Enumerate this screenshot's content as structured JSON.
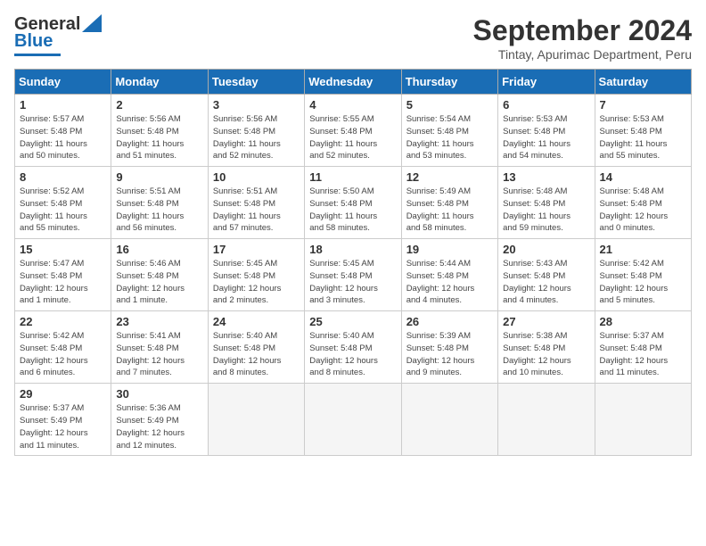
{
  "header": {
    "logo_line1": "General",
    "logo_line2": "Blue",
    "title": "September 2024",
    "subtitle": "Tintay, Apurimac Department, Peru"
  },
  "weekdays": [
    "Sunday",
    "Monday",
    "Tuesday",
    "Wednesday",
    "Thursday",
    "Friday",
    "Saturday"
  ],
  "weeks": [
    [
      {
        "day": "1",
        "info": "Sunrise: 5:57 AM\nSunset: 5:48 PM\nDaylight: 11 hours\nand 50 minutes."
      },
      {
        "day": "2",
        "info": "Sunrise: 5:56 AM\nSunset: 5:48 PM\nDaylight: 11 hours\nand 51 minutes."
      },
      {
        "day": "3",
        "info": "Sunrise: 5:56 AM\nSunset: 5:48 PM\nDaylight: 11 hours\nand 52 minutes."
      },
      {
        "day": "4",
        "info": "Sunrise: 5:55 AM\nSunset: 5:48 PM\nDaylight: 11 hours\nand 52 minutes."
      },
      {
        "day": "5",
        "info": "Sunrise: 5:54 AM\nSunset: 5:48 PM\nDaylight: 11 hours\nand 53 minutes."
      },
      {
        "day": "6",
        "info": "Sunrise: 5:53 AM\nSunset: 5:48 PM\nDaylight: 11 hours\nand 54 minutes."
      },
      {
        "day": "7",
        "info": "Sunrise: 5:53 AM\nSunset: 5:48 PM\nDaylight: 11 hours\nand 55 minutes."
      }
    ],
    [
      {
        "day": "8",
        "info": "Sunrise: 5:52 AM\nSunset: 5:48 PM\nDaylight: 11 hours\nand 55 minutes."
      },
      {
        "day": "9",
        "info": "Sunrise: 5:51 AM\nSunset: 5:48 PM\nDaylight: 11 hours\nand 56 minutes."
      },
      {
        "day": "10",
        "info": "Sunrise: 5:51 AM\nSunset: 5:48 PM\nDaylight: 11 hours\nand 57 minutes."
      },
      {
        "day": "11",
        "info": "Sunrise: 5:50 AM\nSunset: 5:48 PM\nDaylight: 11 hours\nand 58 minutes."
      },
      {
        "day": "12",
        "info": "Sunrise: 5:49 AM\nSunset: 5:48 PM\nDaylight: 11 hours\nand 58 minutes."
      },
      {
        "day": "13",
        "info": "Sunrise: 5:48 AM\nSunset: 5:48 PM\nDaylight: 11 hours\nand 59 minutes."
      },
      {
        "day": "14",
        "info": "Sunrise: 5:48 AM\nSunset: 5:48 PM\nDaylight: 12 hours\nand 0 minutes."
      }
    ],
    [
      {
        "day": "15",
        "info": "Sunrise: 5:47 AM\nSunset: 5:48 PM\nDaylight: 12 hours\nand 1 minute."
      },
      {
        "day": "16",
        "info": "Sunrise: 5:46 AM\nSunset: 5:48 PM\nDaylight: 12 hours\nand 1 minute."
      },
      {
        "day": "17",
        "info": "Sunrise: 5:45 AM\nSunset: 5:48 PM\nDaylight: 12 hours\nand 2 minutes."
      },
      {
        "day": "18",
        "info": "Sunrise: 5:45 AM\nSunset: 5:48 PM\nDaylight: 12 hours\nand 3 minutes."
      },
      {
        "day": "19",
        "info": "Sunrise: 5:44 AM\nSunset: 5:48 PM\nDaylight: 12 hours\nand 4 minutes."
      },
      {
        "day": "20",
        "info": "Sunrise: 5:43 AM\nSunset: 5:48 PM\nDaylight: 12 hours\nand 4 minutes."
      },
      {
        "day": "21",
        "info": "Sunrise: 5:42 AM\nSunset: 5:48 PM\nDaylight: 12 hours\nand 5 minutes."
      }
    ],
    [
      {
        "day": "22",
        "info": "Sunrise: 5:42 AM\nSunset: 5:48 PM\nDaylight: 12 hours\nand 6 minutes."
      },
      {
        "day": "23",
        "info": "Sunrise: 5:41 AM\nSunset: 5:48 PM\nDaylight: 12 hours\nand 7 minutes."
      },
      {
        "day": "24",
        "info": "Sunrise: 5:40 AM\nSunset: 5:48 PM\nDaylight: 12 hours\nand 8 minutes."
      },
      {
        "day": "25",
        "info": "Sunrise: 5:40 AM\nSunset: 5:48 PM\nDaylight: 12 hours\nand 8 minutes."
      },
      {
        "day": "26",
        "info": "Sunrise: 5:39 AM\nSunset: 5:48 PM\nDaylight: 12 hours\nand 9 minutes."
      },
      {
        "day": "27",
        "info": "Sunrise: 5:38 AM\nSunset: 5:48 PM\nDaylight: 12 hours\nand 10 minutes."
      },
      {
        "day": "28",
        "info": "Sunrise: 5:37 AM\nSunset: 5:48 PM\nDaylight: 12 hours\nand 11 minutes."
      }
    ],
    [
      {
        "day": "29",
        "info": "Sunrise: 5:37 AM\nSunset: 5:49 PM\nDaylight: 12 hours\nand 11 minutes."
      },
      {
        "day": "30",
        "info": "Sunrise: 5:36 AM\nSunset: 5:49 PM\nDaylight: 12 hours\nand 12 minutes."
      },
      {
        "day": "",
        "info": ""
      },
      {
        "day": "",
        "info": ""
      },
      {
        "day": "",
        "info": ""
      },
      {
        "day": "",
        "info": ""
      },
      {
        "day": "",
        "info": ""
      }
    ]
  ]
}
